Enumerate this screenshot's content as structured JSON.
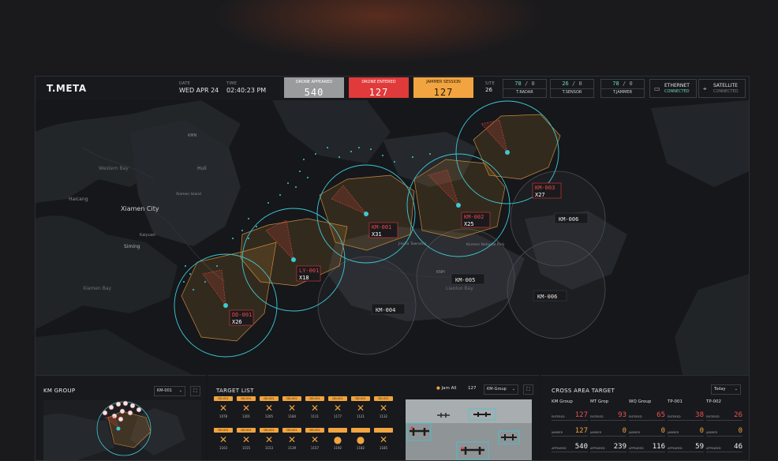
{
  "header": {
    "brand": "T.META",
    "date_label": "DATE",
    "date_value": "WED APR 24",
    "time_label": "TIME",
    "time_value": "02:40:23 PM",
    "stats": {
      "appeared_label": "DRONE APPEARED",
      "appeared_value": "540",
      "entered_label": "DRONE ENTERED",
      "entered_value": "127",
      "jammer_label": "JAMMER SESSION",
      "jammer_value": "127"
    },
    "site_label": "SITE",
    "site_value": "26",
    "devices": [
      {
        "on": "78",
        "off": "0",
        "label": "T.RADAR"
      },
      {
        "on": "26",
        "off": "0",
        "label": "T.SENSOR"
      },
      {
        "on": "78",
        "off": "0",
        "label": "T.JAMMER"
      }
    ],
    "ethernet": {
      "label": "ETHERNET",
      "status": "CONNECTED",
      "icon": "monitor-icon"
    },
    "satellite": {
      "label": "SATELLITE",
      "status": "CONNECTED",
      "icon": "satellite-icon"
    },
    "colors": {
      "accent_green": "#6fd3a6",
      "alert_red": "#e03a3a",
      "warn_orange": "#f1a440",
      "neutral": "#9a9b9d",
      "radar_cyan": "#3ec9d3"
    }
  },
  "map": {
    "place_labels": [
      "Western Bay",
      "Haicang",
      "Xiamen City",
      "Kaiyuan",
      "Siming",
      "Xiamen Bay",
      "Huli",
      "KMN",
      "Xiamen Island",
      "Liaoluo Bay",
      "KNH",
      "Kinmen National Park",
      "Jinsha Township"
    ],
    "zones": [
      {
        "id": "DD-001",
        "count": "26",
        "status": "alert"
      },
      {
        "id": "LY-001",
        "count": "18",
        "status": "alert"
      },
      {
        "id": "KM-001",
        "count": "31",
        "status": "alert"
      },
      {
        "id": "KM-002",
        "count": "25",
        "status": "alert"
      },
      {
        "id": "KM-003",
        "count": "27",
        "status": "alert"
      },
      {
        "id": "KM-004",
        "status": "idle"
      },
      {
        "id": "KM-005",
        "status": "idle"
      },
      {
        "id": "KM-006",
        "status": "idle"
      },
      {
        "id": "KM-006",
        "status": "idle"
      }
    ],
    "count_prefix": "X"
  },
  "km_group": {
    "title": "KM GROUP",
    "select_value": "KM-001",
    "select_icon": "chevron-down-icon",
    "expand_icon": "expand-icon"
  },
  "target_list": {
    "title": "TARGET LIST",
    "jam_all_label": "Jam All",
    "jam_all_icon": "jammer-icon",
    "count": "127",
    "group_select": "KM-Group",
    "tags_row1": [
      "DD-001",
      "DD-001",
      "DD-001",
      "DD-001",
      "DD-001",
      "DD-001",
      "DD-001",
      "DD-001"
    ],
    "nums_row1": [
      "1078",
      "1201",
      "1205",
      "1184",
      "1111",
      "1177",
      "1121",
      "1132"
    ],
    "tags_row2": [
      "DD-001",
      "DD-001",
      "DD-001",
      "DD-001",
      "DD-001",
      "",
      "",
      ""
    ],
    "nums_row2": [
      "1103",
      "1155",
      "1153",
      "1139",
      "1157",
      "1192",
      "1182",
      "1185"
    ]
  },
  "cross_area": {
    "title": "CROSS AREA TARGET",
    "range_select": "Today",
    "row_labels": {
      "entered": "ENTERED",
      "jammer": "JAMMER",
      "appeared": "APPEARED"
    },
    "groups": [
      {
        "name": "KM Group",
        "entered": "127",
        "jammer": "127",
        "appeared": "540"
      },
      {
        "name": "MT Grop",
        "entered": "93",
        "jammer": "0",
        "appeared": "239"
      },
      {
        "name": "WQ Group",
        "entered": "65",
        "jammer": "0",
        "appeared": "116"
      },
      {
        "name": "TP-001",
        "entered": "38",
        "jammer": "0",
        "appeared": "59"
      },
      {
        "name": "TP-002",
        "entered": "26",
        "jammer": "0",
        "appeared": "46"
      }
    ]
  }
}
